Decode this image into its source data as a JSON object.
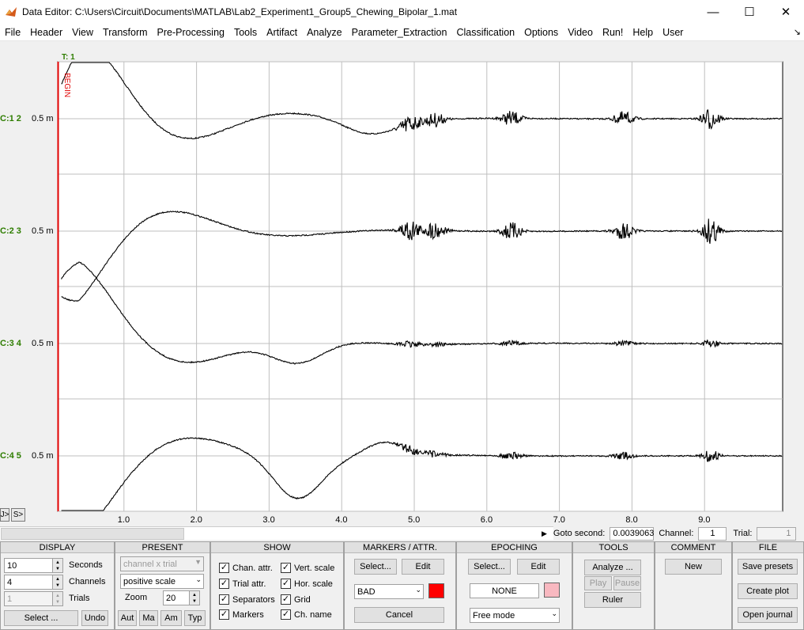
{
  "window": {
    "title": "Data Editor: C:\\Users\\Circuit\\Documents\\MATLAB\\Lab2_Experiment1_Group5_Chewing_Bipolar_1.mat",
    "minimize": "—",
    "maximize": "☐",
    "close": "✕"
  },
  "menu": [
    "File",
    "Header",
    "View",
    "Transform",
    "Pre-Processing",
    "Tools",
    "Artifact",
    "Analyze",
    "Parameter_Extraction",
    "Classification",
    "Options",
    "Video",
    "Run!",
    "Help",
    "User"
  ],
  "menu_arrow": "↘",
  "plot": {
    "trial_label": "T: 1",
    "begin_label": "BEGIN",
    "channels": [
      {
        "label": "C:1 2",
        "scale": "0.5 m"
      },
      {
        "label": "C:2 3",
        "scale": "0.5 m"
      },
      {
        "label": "C:3 4",
        "scale": "0.5 m"
      },
      {
        "label": "C:4 5",
        "scale": "0.5 m"
      }
    ],
    "x_ticks": [
      "1.0",
      "2.0",
      "3.0",
      "4.0",
      "5.0",
      "6.0",
      "7.0",
      "8.0",
      "9.0"
    ],
    "nav_prev": "J>",
    "nav_next": "S>"
  },
  "goto": {
    "label": "Goto second:",
    "value": "0.0039063",
    "channel_label": "Channel:",
    "channel_value": "1",
    "trial_label": "Trial:",
    "trial_value": "1"
  },
  "display": {
    "header": "DISPLAY",
    "seconds_value": "10",
    "seconds_label": "Seconds",
    "channels_value": "4",
    "channels_label": "Channels",
    "trials_value": "1",
    "trials_label": "Trials",
    "select_label": "Select ...",
    "undo_label": "Undo"
  },
  "present": {
    "header": "PRESENT",
    "mode": "channel x trial",
    "scale": "positive scale",
    "zoom_label": "Zoom",
    "zoom_value": "20",
    "buttons": [
      "Aut",
      "Ma",
      "Am",
      "Typ"
    ]
  },
  "show": {
    "header": "SHOW",
    "options": [
      {
        "label": "Chan. attr.",
        "checked": true
      },
      {
        "label": "Vert. scale",
        "checked": true
      },
      {
        "label": "Trial attr.",
        "checked": true
      },
      {
        "label": "Hor. scale",
        "checked": true
      },
      {
        "label": "Separators",
        "checked": true
      },
      {
        "label": "Grid",
        "checked": true
      },
      {
        "label": "Markers",
        "checked": true
      },
      {
        "label": "Ch. name",
        "checked": true
      }
    ]
  },
  "markers": {
    "header": "MARKERS / ATTR.",
    "select_label": "Select...",
    "edit_label": "Edit",
    "attr_value": "BAD",
    "attr_color": "#ff0000",
    "cancel_label": "Cancel"
  },
  "epoching": {
    "header": "EPOCHING",
    "select_label": "Select...",
    "edit_label": "Edit",
    "value": "NONE",
    "color": "#f8b8c0",
    "mode": "Free mode"
  },
  "tools": {
    "header": "TOOLS",
    "analyze_label": "Analyze ...",
    "play_label": "Play",
    "pause_label": "Pause",
    "ruler_label": "Ruler"
  },
  "comment": {
    "header": "COMMENT",
    "new_label": "New"
  },
  "file": {
    "header": "FILE",
    "save_label": "Save presets",
    "create_label": "Create plot",
    "journal_label": "Open journal"
  }
}
